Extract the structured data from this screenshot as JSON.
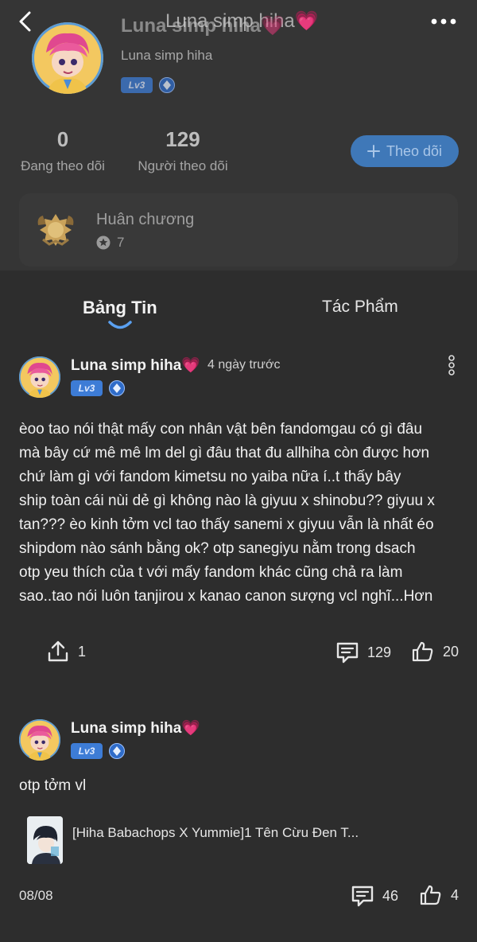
{
  "topbar": {
    "title": "Luna simp hiha💗",
    "back_icon": "chevron-left-icon",
    "more_icon": "more-horizontal-icon"
  },
  "profile": {
    "name": "Luna simp hiha💗",
    "handle": "Luna simp hiha",
    "level": "Lv3",
    "following_count": "0",
    "following_label": "Đang theo dõi",
    "followers_count": "129",
    "followers_label": "Người theo dõi",
    "follow_button": "Theo dõi"
  },
  "medal": {
    "title": "Huân chương",
    "count": "7"
  },
  "tabs": [
    {
      "label": "Bảng Tin",
      "active": true
    },
    {
      "label": "Tác Phẩm",
      "active": false
    }
  ],
  "posts": [
    {
      "author": "Luna simp hiha💗",
      "time": "4 ngày trước",
      "level": "Lv3",
      "body_lines": [
        "èoo tao nói thật mấy con nhân vật bên fandomgau có gì đâu",
        "mà bây cứ mê mê lm del gì đâu that đu allhiha còn được hơn",
        "chứ làm gì với fandom kimetsu no yaiba nữa í..t thấy bây",
        "ship toàn cái nùi dẻ gì không nào là giyuu x shinobu?? giyuu x",
        "tan??? èo kinh tởm vcl tao thấy sanemi x giyuu vẫn là nhất éo",
        "shipdom nào sánh bằng ok? otp sanegiyu nằm trong dsach",
        "otp yeu thích của t với mấy fandom khác cũng chả ra làm",
        "sao..tao nói luôn tanjirou x kanao canon sượng vcl nghĩ...Hơn"
      ],
      "shares": "1",
      "comments": "129",
      "likes": "20"
    },
    {
      "author": "Luna simp hiha💗",
      "level": "Lv3",
      "body": "otp tởm vl",
      "shared_title": "[Hiha Babachops X Yummie]1 Tên Cừu Đen T...",
      "date": "08/08",
      "comments": "46",
      "likes": "4"
    }
  ],
  "colors": {
    "background": "#2d2d2d",
    "header": "#353535",
    "accent_blue": "#3d7cd6",
    "follow_button": "#3f78b8"
  }
}
